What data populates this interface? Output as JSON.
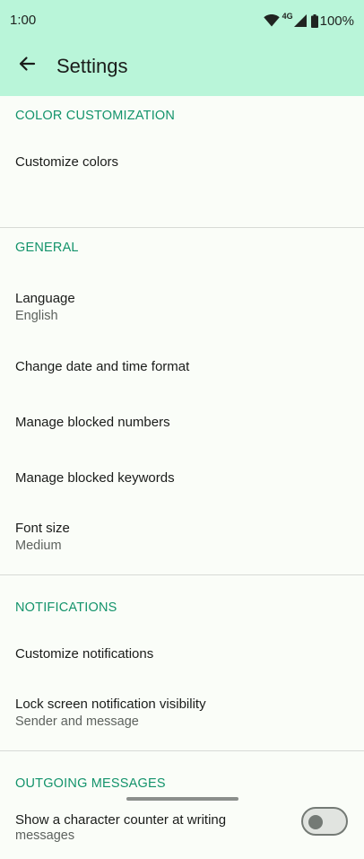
{
  "status": {
    "time": "1:00",
    "network": "4G",
    "battery": "100%",
    "icons": [
      "wifi-icon",
      "cell-signal-icon",
      "battery-icon"
    ]
  },
  "toolbar": {
    "title": "Settings",
    "back_icon": "arrow-back-icon"
  },
  "colors": {
    "appbar": "#b9f5d9",
    "accent": "#13936b",
    "background": "#fafdf8"
  },
  "sections": {
    "color": {
      "header": "COLOR CUSTOMIZATION",
      "items": [
        {
          "title": "Customize colors"
        }
      ]
    },
    "general": {
      "header": "GENERAL",
      "items": [
        {
          "title": "Language",
          "subtitle": "English"
        },
        {
          "title": "Change date and time format"
        },
        {
          "title": "Manage blocked numbers"
        },
        {
          "title": "Manage blocked keywords"
        },
        {
          "title": "Font size",
          "subtitle": "Medium"
        }
      ]
    },
    "notifications": {
      "header": "NOTIFICATIONS",
      "items": [
        {
          "title": "Customize notifications"
        },
        {
          "title": "Lock screen notification visibility",
          "subtitle": "Sender and message"
        }
      ]
    },
    "outgoing": {
      "header": "OUTGOING MESSAGES",
      "items": [
        {
          "title": "Show a character counter at writing",
          "subtitle": "messages",
          "toggle": "off"
        }
      ]
    }
  }
}
